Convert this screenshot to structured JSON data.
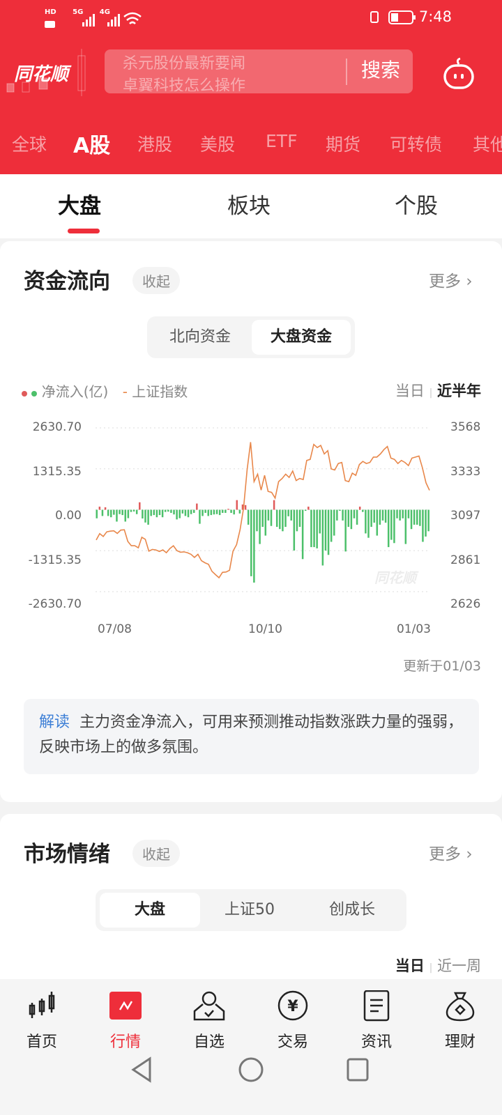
{
  "status_bar": {
    "left": "HD 5G 4G",
    "time": "7:48"
  },
  "header": {
    "logo": "同花顺",
    "search_ticker": [
      "杀元股份最新要闻",
      "卓翼科技怎么操作"
    ],
    "search_button": "搜索",
    "robot_icon": "robot-icon"
  },
  "market_tabs": [
    {
      "label": "全球"
    },
    {
      "label": "A股",
      "active": true
    },
    {
      "label": "港股"
    },
    {
      "label": "美股"
    },
    {
      "label": "ETF"
    },
    {
      "label": "期货"
    },
    {
      "label": "可转债"
    },
    {
      "label": "其他"
    }
  ],
  "sub_tabs": [
    {
      "label": "大盘",
      "active": true
    },
    {
      "label": "板块"
    },
    {
      "label": "个股"
    }
  ],
  "fund_flow": {
    "title": "资金流向",
    "collapse": "收起",
    "more": "更多",
    "segments": [
      {
        "label": "北向资金"
      },
      {
        "label": "大盘资金",
        "active": true
      }
    ],
    "legend": {
      "net_inflow": "净流入(亿)",
      "index": "上证指数"
    },
    "range": {
      "today": "当日",
      "half_year": "近半年",
      "active": "近半年"
    },
    "updated": "更新于01/03",
    "note_label": "解读",
    "note_text": "主力资金净流入，可用来预测推动指数涨跌力量的强弱，反映市场上的做多氛围。",
    "watermark": "同花顺"
  },
  "chart_data": {
    "type": "bar+line",
    "colors": {
      "positive": "#e05a5a",
      "negative": "#4cc06a",
      "line": "#e8874a"
    },
    "left_axis": {
      "ticks": [
        "2630.70",
        "1315.35",
        "0.00",
        "-1315.35",
        "-2630.70"
      ],
      "range": [
        -2630.7,
        2630.7
      ]
    },
    "right_axis": {
      "ticks": [
        "3568",
        "3333",
        "3097",
        "2861",
        "2626"
      ],
      "range": [
        2626,
        3568
      ]
    },
    "x_ticks": [
      "07/08",
      "10/10",
      "01/03"
    ],
    "grid": true,
    "series": [
      {
        "name": "净流入(亿)",
        "type": "bar",
        "values": [
          -275,
          100,
          -200,
          80,
          -200,
          -240,
          -160,
          -380,
          -140,
          -170,
          -380,
          -270,
          -70,
          -55,
          -140,
          240,
          -280,
          -410,
          -480,
          -200,
          -170,
          -240,
          -170,
          -240,
          -70,
          -60,
          -100,
          -150,
          -310,
          -270,
          -120,
          -200,
          -240,
          -140,
          -100,
          200,
          -450,
          -200,
          -100,
          -200,
          -170,
          -150,
          -140,
          -170,
          -100,
          -100,
          30,
          -100,
          -150,
          310,
          -120,
          170,
          150,
          -480,
          -2135,
          -2340,
          -690,
          -1100,
          -550,
          -830,
          -345,
          -520,
          310,
          -550,
          -620,
          -690,
          -550,
          -210,
          -345,
          -1310,
          -690,
          -550,
          -1585,
          -35,
          100,
          -1200,
          -1200,
          -1240,
          -760,
          -1790,
          -1310,
          -1450,
          -1030,
          -830,
          -345,
          -35,
          -345,
          -1340,
          -550,
          -620,
          -275,
          -480,
          100,
          -70,
          -760,
          -900,
          -550,
          -415,
          -830,
          -480,
          -345,
          -415,
          -1200,
          -965,
          -1070,
          -275,
          -345,
          -275,
          -1100,
          -275,
          -620,
          -480,
          -480,
          -520,
          -1030,
          -860,
          -690
        ]
      },
      {
        "name": "上证指数",
        "type": "line",
        "values": [
          2923,
          2960,
          2943,
          2970,
          2974,
          2976,
          2961,
          2980,
          2982,
          2915,
          2890,
          2890,
          2878,
          2939,
          2927,
          2859,
          2869,
          2866,
          2857,
          2866,
          2850,
          2874,
          2890,
          2862,
          2853,
          2855,
          2850,
          2841,
          2823,
          2841,
          2804,
          2792,
          2783,
          2743,
          2724,
          2706,
          2737,
          2739,
          2749,
          2859,
          2896,
          2982,
          3105,
          3326,
          3486,
          3259,
          3302,
          3210,
          3295,
          3203,
          3197,
          3164,
          3259,
          3277,
          3302,
          3283,
          3320,
          3265,
          3277,
          3271,
          3381,
          3387,
          3473,
          3455,
          3467,
          3418,
          3437,
          3332,
          3326,
          3363,
          3369,
          3265,
          3259,
          3308,
          3295,
          3357,
          3375,
          3363,
          3369,
          3400,
          3400,
          3418,
          3443,
          3461,
          3394,
          3387,
          3363,
          3381,
          3369,
          3351,
          3394,
          3400,
          3406,
          3338,
          3252,
          3209
        ]
      }
    ]
  },
  "sentiment": {
    "title": "市场情绪",
    "collapse": "收起",
    "more": "更多",
    "segments": [
      {
        "label": "大盘",
        "active": true
      },
      {
        "label": "上证50"
      },
      {
        "label": "创成长"
      }
    ],
    "range": {
      "today": "当日",
      "week": "近一周"
    }
  },
  "bottom_nav": [
    {
      "label": "首页",
      "icon": "candlestick-icon"
    },
    {
      "label": "行情",
      "icon": "market-icon",
      "active": true
    },
    {
      "label": "自选",
      "icon": "watchlist-user-icon"
    },
    {
      "label": "交易",
      "icon": "yen-coin-icon"
    },
    {
      "label": "资讯",
      "icon": "news-doc-icon"
    },
    {
      "label": "理财",
      "icon": "money-bag-icon"
    }
  ],
  "accent": "#ee2e3a"
}
